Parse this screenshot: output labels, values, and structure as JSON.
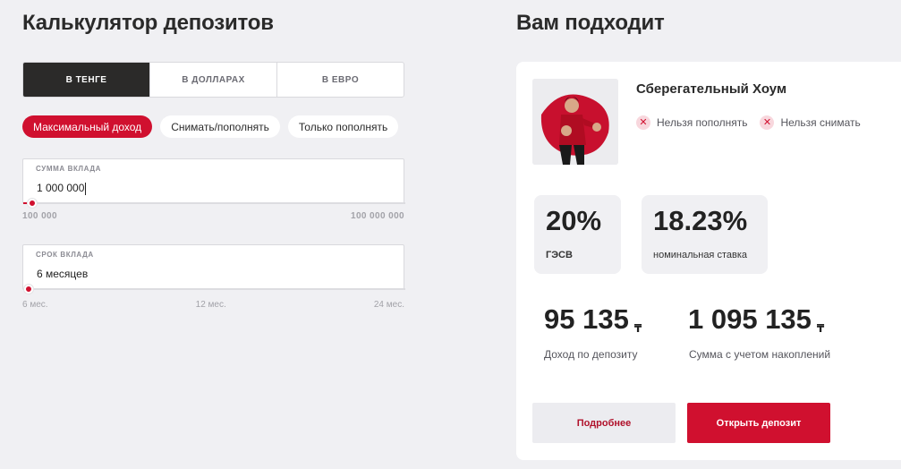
{
  "calculator": {
    "title": "Калькулятор депозитов",
    "currency_tabs": [
      "В ТЕНГЕ",
      "В ДОЛЛАРАХ",
      "В ЕВРО"
    ],
    "active_currency_index": 0,
    "filters": [
      "Максимальный доход",
      "Снимать/пополнять",
      "Только пополнять"
    ],
    "active_filter_index": 0,
    "amount": {
      "label": "СУММА ВКЛАДА",
      "value": "1 000 000",
      "min_label": "100 000",
      "max_label": "100 000 000",
      "slider_fraction": 0.009
    },
    "term": {
      "label": "СРОК ВКЛАДА",
      "value": "6 месяцев",
      "ticks": [
        "6 мес.",
        "12 мес.",
        "24 мес."
      ],
      "slider_fraction": 0.0
    }
  },
  "result": {
    "title": "Вам подходит",
    "product_name": "Сберегательный Хоум",
    "tags": [
      {
        "icon": "x-icon",
        "label": "Нельзя пополнять"
      },
      {
        "icon": "x-icon",
        "label": "Нельзя снимать"
      }
    ],
    "gesv": {
      "value": "20%",
      "label": "ГЭСВ"
    },
    "nominal": {
      "value": "18.23%",
      "label": "номинальная ставка"
    },
    "income": {
      "value": "95 135",
      "currency": "₸",
      "label": "Доход по депозиту"
    },
    "total": {
      "value": "1 095 135",
      "currency": "₸",
      "label": "Сумма с учетом накоплений"
    },
    "more_button": "Подробнее",
    "open_button": "Открыть депозит"
  },
  "colors": {
    "accent": "#d0102f",
    "dark": "#2b2a29",
    "background": "#f0f0f3"
  }
}
